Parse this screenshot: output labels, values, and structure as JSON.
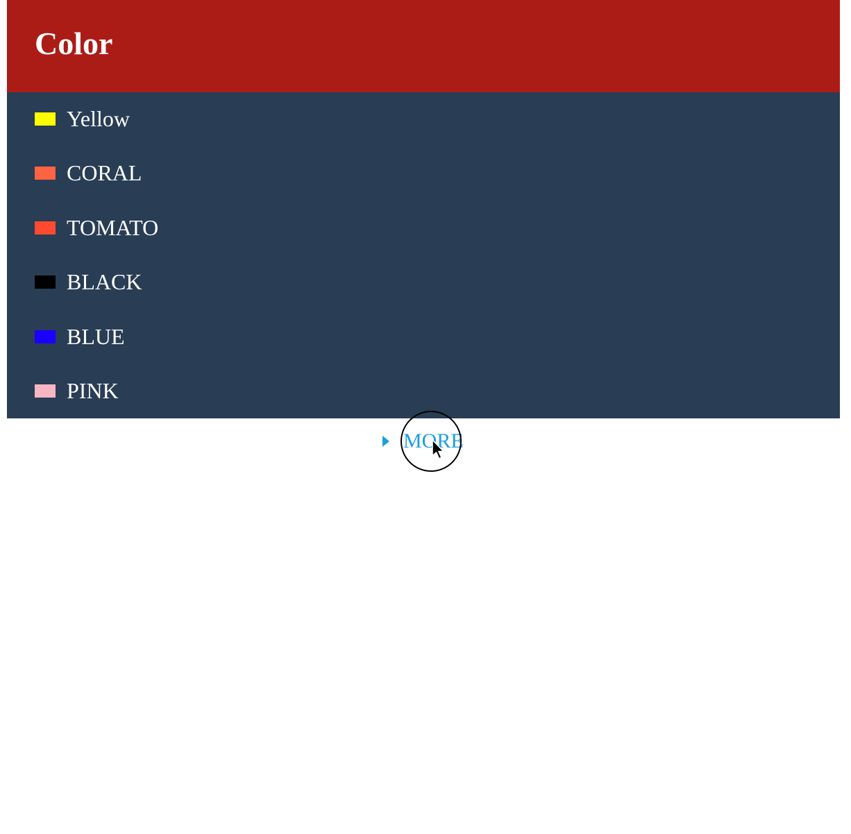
{
  "header": {
    "title": "Color",
    "background": "#ab1c17"
  },
  "list": {
    "background": "#293d55",
    "items": [
      {
        "label": "Yellow",
        "swatch": "#ffff00"
      },
      {
        "label": "CORAL",
        "swatch": "#ff6342"
      },
      {
        "label": "TOMATO",
        "swatch": "#ff4a30"
      },
      {
        "label": "BLACK",
        "swatch": "#000000"
      },
      {
        "label": "BLUE",
        "swatch": "#1a00ff"
      },
      {
        "label": "PINK",
        "swatch": "#f7b6c2"
      }
    ]
  },
  "more": {
    "label": "MORE",
    "color": "#1b9ee0",
    "icon": "caret-right-icon"
  },
  "cursor": {
    "icon": "mouse-pointer-icon"
  }
}
